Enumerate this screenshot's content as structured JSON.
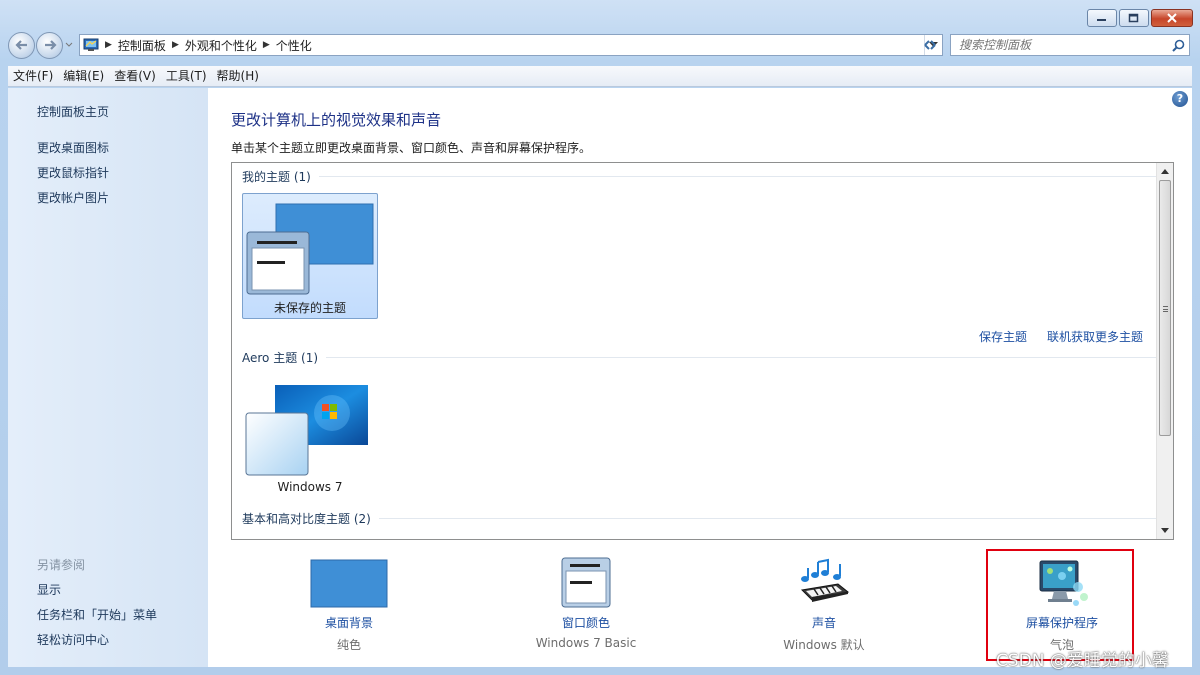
{
  "window": {
    "caption": {
      "minimize": "minimize",
      "maximize": "maximize",
      "close": "close"
    }
  },
  "address": {
    "crumbs": [
      "控制面板",
      "外观和个性化",
      "个性化"
    ],
    "search_placeholder": "搜索控制面板"
  },
  "menu": [
    "文件(F)",
    "编辑(E)",
    "查看(V)",
    "工具(T)",
    "帮助(H)"
  ],
  "sidebar": {
    "top_links": [
      "控制面板主页",
      "更改桌面图标",
      "更改鼠标指针",
      "更改帐户图片"
    ],
    "see_also_heading": "另请参阅",
    "see_also_links": [
      "显示",
      "任务栏和「开始」菜单",
      "轻松访问中心"
    ]
  },
  "main": {
    "title": "更改计算机上的视觉效果和声音",
    "subtitle": "单击某个主题立即更改桌面背景、窗口颜色、声音和屏幕保护程序。",
    "groups": {
      "my_themes": "我的主题 (1)",
      "aero_themes": "Aero 主题 (1)",
      "basic_themes": "基本和高对比度主题 (2)"
    },
    "themes": {
      "unsaved": "未保存的主题",
      "windows7": "Windows 7"
    },
    "links": {
      "save_theme": "保存主题",
      "get_more": "联机获取更多主题"
    },
    "bottom": [
      {
        "label": "桌面背景",
        "sub": "纯色"
      },
      {
        "label": "窗口颜色",
        "sub": "Windows 7 Basic"
      },
      {
        "label": "声音",
        "sub": "Windows 默认"
      },
      {
        "label": "屏幕保护程序",
        "sub": "气泡"
      }
    ],
    "help_glyph": "?"
  },
  "watermark": "CSDN @爱睡觉的小馨",
  "colors": {
    "accent_link": "#1e50a2",
    "title_blue": "#1e3287",
    "desktop_blue": "#3f8fd6",
    "highlight_red": "#e0000f"
  }
}
